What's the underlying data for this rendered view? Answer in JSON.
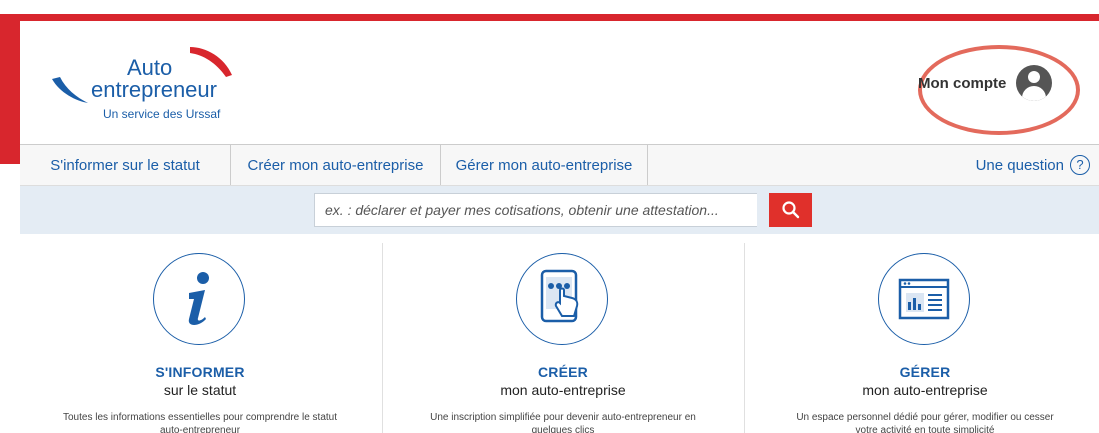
{
  "logo": {
    "line1": "Auto",
    "line2": "entrepreneur",
    "tagline": "Un service des Urssaf"
  },
  "account": {
    "label": "Mon compte",
    "icon": "user-avatar-icon"
  },
  "nav": {
    "items": [
      {
        "label": "S'informer sur le statut"
      },
      {
        "label": "Créer mon auto-entreprise"
      },
      {
        "label": "Gérer mon auto-entreprise"
      }
    ],
    "question": {
      "label": "Une question",
      "icon": "question-circle-icon"
    }
  },
  "search": {
    "placeholder": "ex. : déclarer et payer mes cotisations, obtenir une attestation...",
    "button_icon": "search-icon"
  },
  "cards": [
    {
      "icon": "info-icon",
      "title": "S'INFORMER",
      "subtitle": "sur le statut",
      "description": "Toutes les informations essentielles pour comprendre le statut auto-entrepreneur"
    },
    {
      "icon": "tablet-touch-icon",
      "title": "CRÉER",
      "subtitle": "mon auto-entreprise",
      "description": "Une inscription simplifiée pour devenir auto-entrepreneur en quelques clics"
    },
    {
      "icon": "dashboard-window-icon",
      "title": "GÉRER",
      "subtitle": "mon auto-entreprise",
      "description": "Un espace personnel dédié pour gérer, modifier ou cesser votre activité en toute simplicité"
    }
  ],
  "colors": {
    "brand_blue": "#1b5ea8",
    "brand_red": "#d8262d",
    "search_button": "#e0302b",
    "highlight_ring": "#e36a5c"
  }
}
